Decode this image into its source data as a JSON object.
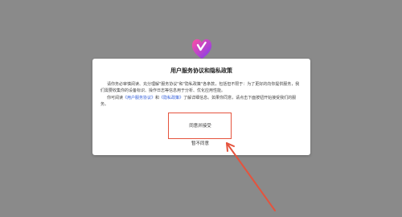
{
  "dialog": {
    "title": "用户服务协议和隐私政策",
    "paragraph1": "请你务必审慎阅读、充分理解\"服务协议\"和\"隐私政策\"各条款，包括但不限于：为了更好的向你提供服务，我们需要收集你的设备标识、操作日志等信息用于分析、优化应用性能。",
    "paragraph2_prefix": "你可阅读",
    "service_link": "《用户服务协议》",
    "paragraph2_and": "和",
    "privacy_link": "《隐私政策》",
    "paragraph2_suffix": "了解详细信息。如果你同意，请点击下面按钮开始接受我们的服务。",
    "agree_label": "同意并接受",
    "disagree_label": "暂不同意"
  },
  "colors": {
    "overlay": "#8a8a8a",
    "link": "#2f5bd8",
    "annotation": "#e5533d"
  },
  "icons": {
    "logo": "app-logo-icon"
  }
}
